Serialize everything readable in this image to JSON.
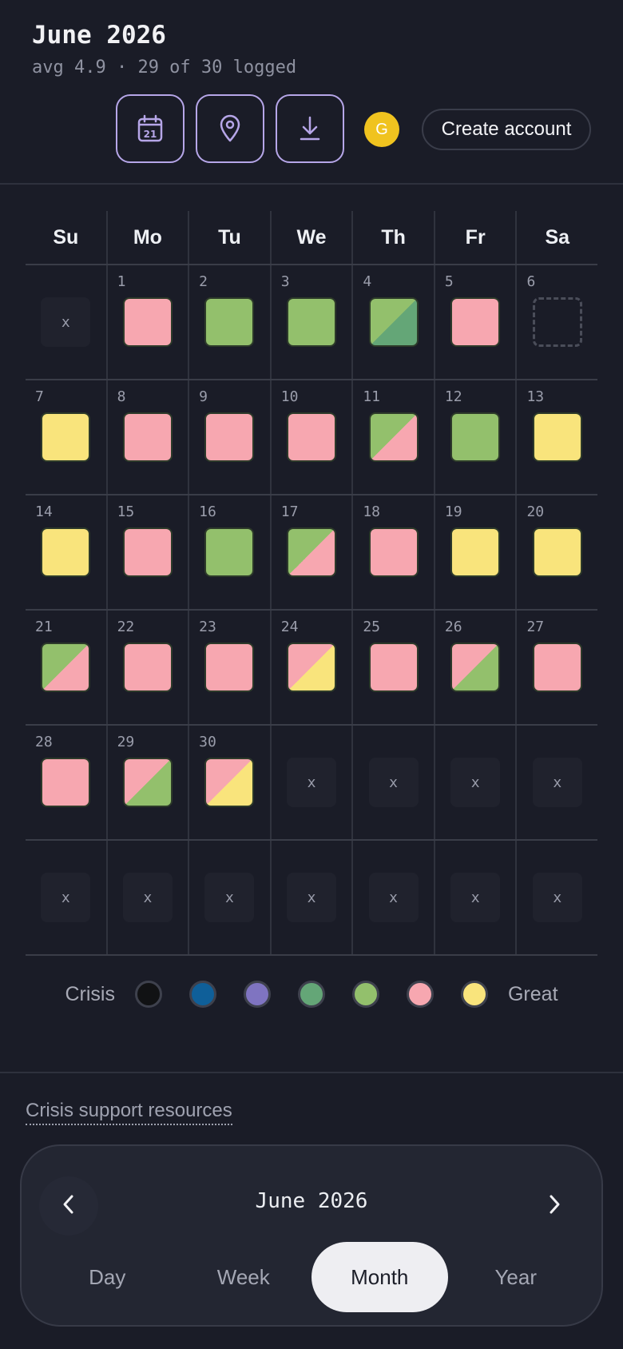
{
  "header": {
    "title": "June 2026",
    "subtitle": "avg 4.9 · 29 of 30 logged",
    "avatar_letter": "G",
    "create_account_label": "Create account",
    "icons": [
      "calendar-icon",
      "map-pin-icon",
      "download-icon"
    ]
  },
  "calendar": {
    "weekdays": [
      "Su",
      "Mo",
      "Tu",
      "We",
      "Th",
      "Fr",
      "Sa"
    ],
    "empty_mark": "x",
    "weeks": [
      [
        null,
        {
          "day": "1",
          "mood": [
            "pink"
          ]
        },
        {
          "day": "2",
          "mood": [
            "lime"
          ]
        },
        {
          "day": "3",
          "mood": [
            "lime"
          ]
        },
        {
          "day": "4",
          "mood": [
            "lime",
            "green"
          ]
        },
        {
          "day": "5",
          "mood": [
            "pink"
          ]
        },
        {
          "day": "6",
          "mood": []
        }
      ],
      [
        {
          "day": "7",
          "mood": [
            "yellow"
          ]
        },
        {
          "day": "8",
          "mood": [
            "pink"
          ]
        },
        {
          "day": "9",
          "mood": [
            "pink"
          ]
        },
        {
          "day": "10",
          "mood": [
            "pink"
          ]
        },
        {
          "day": "11",
          "mood": [
            "lime",
            "pink"
          ]
        },
        {
          "day": "12",
          "mood": [
            "lime"
          ]
        },
        {
          "day": "13",
          "mood": [
            "yellow"
          ]
        }
      ],
      [
        {
          "day": "14",
          "mood": [
            "yellow"
          ]
        },
        {
          "day": "15",
          "mood": [
            "pink"
          ]
        },
        {
          "day": "16",
          "mood": [
            "lime"
          ]
        },
        {
          "day": "17",
          "mood": [
            "lime",
            "pink"
          ]
        },
        {
          "day": "18",
          "mood": [
            "pink"
          ]
        },
        {
          "day": "19",
          "mood": [
            "yellow"
          ]
        },
        {
          "day": "20",
          "mood": [
            "yellow"
          ]
        }
      ],
      [
        {
          "day": "21",
          "mood": [
            "lime",
            "pink"
          ]
        },
        {
          "day": "22",
          "mood": [
            "pink"
          ]
        },
        {
          "day": "23",
          "mood": [
            "pink"
          ]
        },
        {
          "day": "24",
          "mood": [
            "pink",
            "yellow"
          ]
        },
        {
          "day": "25",
          "mood": [
            "pink"
          ]
        },
        {
          "day": "26",
          "mood": [
            "pink",
            "lime"
          ]
        },
        {
          "day": "27",
          "mood": [
            "pink"
          ]
        }
      ],
      [
        {
          "day": "28",
          "mood": [
            "pink"
          ]
        },
        {
          "day": "29",
          "mood": [
            "pink",
            "lime"
          ]
        },
        {
          "day": "30",
          "mood": [
            "pink",
            "yellow"
          ]
        },
        null,
        null,
        null,
        null
      ],
      [
        null,
        null,
        null,
        null,
        null,
        null,
        null
      ]
    ]
  },
  "mood_colors": {
    "black": "#111214",
    "blue": "#0f5f99",
    "purple": "#7f74c1",
    "green": "#64a677",
    "lime": "#93c06c",
    "pink": "#f7a7b0",
    "yellow": "#f9e47c"
  },
  "legend": {
    "low_label": "Crisis",
    "high_label": "Great",
    "scale": [
      "black",
      "blue",
      "purple",
      "green",
      "lime",
      "pink",
      "yellow"
    ]
  },
  "footer": {
    "crisis_link": "Crisis support resources"
  },
  "navigator": {
    "period_label": "June 2026",
    "tabs": [
      "Day",
      "Week",
      "Month",
      "Year"
    ],
    "active_tab": "Month"
  }
}
